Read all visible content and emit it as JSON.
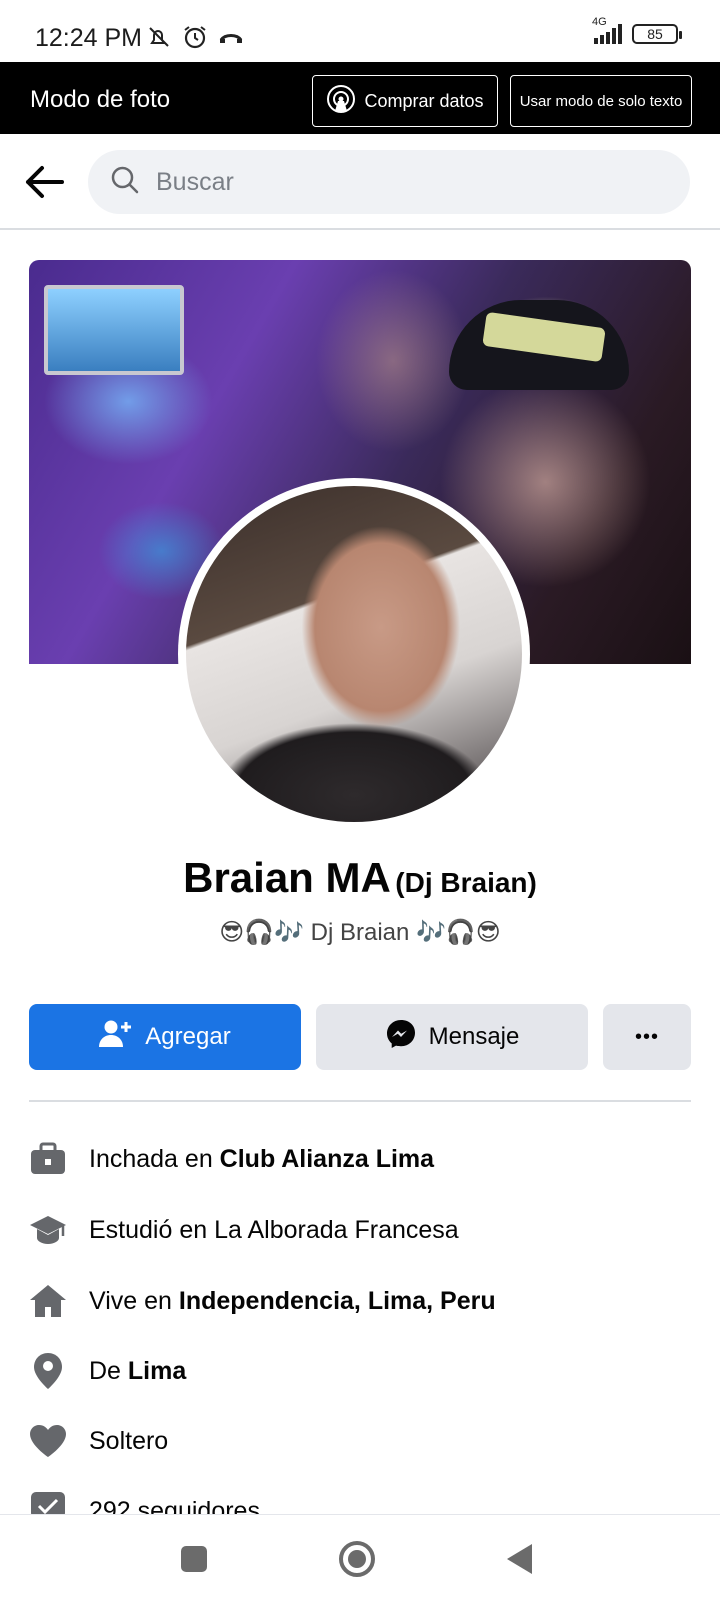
{
  "status_bar": {
    "time": "12:24 PM",
    "network": "4G",
    "battery": "85",
    "icons": [
      "mute-icon",
      "alarm-icon",
      "call-forward-icon",
      "signal-icon",
      "battery-icon"
    ]
  },
  "mode_bar": {
    "title": "Modo de foto",
    "buy_data_label": "Comprar datos",
    "text_mode_label": "Usar modo de solo texto"
  },
  "search": {
    "placeholder": "Buscar"
  },
  "profile": {
    "name": "Braian MA",
    "alt_name": "(Dj Braian)",
    "bio": "😎🎧🎶 Dj Braian 🎶🎧😎"
  },
  "actions": {
    "add_label": "Agregar",
    "message_label": "Mensaje",
    "more_label": "•••"
  },
  "details": [
    {
      "prefix": "Inchada en ",
      "bold": "Club Alianza Lima",
      "icon": "briefcase-icon"
    },
    {
      "prefix": "Estudió en La Alborada Francesa",
      "bold": "",
      "icon": "graduation-cap-icon"
    },
    {
      "prefix": "Vive en ",
      "bold": "Independencia, Lima, Peru",
      "icon": "home-icon"
    },
    {
      "prefix": "De ",
      "bold": "Lima",
      "icon": "location-pin-icon"
    },
    {
      "prefix": "Soltero",
      "bold": "",
      "icon": "heart-icon"
    },
    {
      "prefix": "292 seguidores",
      "bold": "",
      "icon": "followers-icon"
    }
  ],
  "colors": {
    "primary": "#1b74e4",
    "secondary_button": "#e4e6eb",
    "search_bg": "#f0f2f5",
    "icon_gray": "#65676b",
    "banner_bg": "#000000"
  }
}
